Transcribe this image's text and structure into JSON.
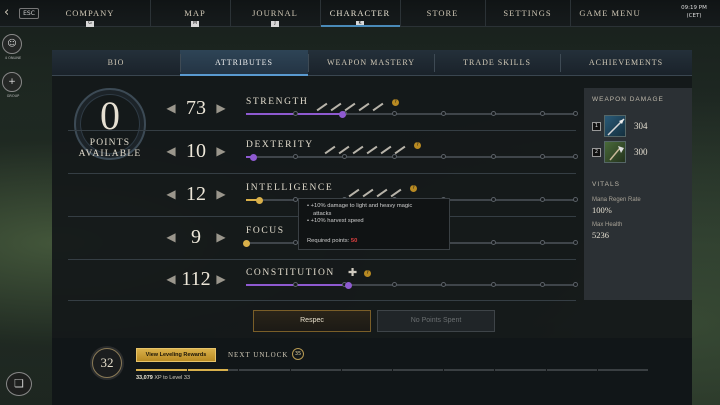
{
  "topnav": {
    "back_glyph": "‹",
    "esc_label": "ESC",
    "items": [
      {
        "label": "COMPANY",
        "hotkey": "G"
      },
      {
        "label": "MAP",
        "hotkey": "M"
      },
      {
        "label": "JOURNAL",
        "hotkey": "J"
      },
      {
        "label": "CHARACTER",
        "hotkey": "K"
      },
      {
        "label": "STORE",
        "hotkey": ""
      },
      {
        "label": "SETTINGS",
        "hotkey": ""
      },
      {
        "label": "GAME MENU",
        "hotkey": ""
      }
    ],
    "active_index": 3,
    "clock_time": "09:19 PM",
    "clock_tz": "(CET)"
  },
  "side": {
    "online_label": "4 ONLINE",
    "invite_label": "GROUP",
    "chat_icon": "chat-bubble-icon"
  },
  "subtabs": {
    "items": [
      "BIO",
      "ATTRIBUTES",
      "WEAPON MASTERY",
      "TRADE SKILLS",
      "ACHIEVEMENTS"
    ],
    "active_index": 1
  },
  "points": {
    "value": "0",
    "label_line1": "POINTS",
    "label_line2": "AVAILABLE"
  },
  "attributes": [
    {
      "name": "STRENGTH",
      "value": "73",
      "fill": 0.29,
      "color": "#8e5ad0",
      "info": "?",
      "weapons": 5,
      "plus": ""
    },
    {
      "name": "DEXTERITY",
      "value": "10",
      "fill": 0.02,
      "color": "#8e5ad0",
      "info": "?",
      "weapons": 6,
      "plus": ""
    },
    {
      "name": "INTELLIGENCE",
      "value": "12",
      "fill": 0.04,
      "color": "#d9b04a",
      "info": "?",
      "weapons": 4,
      "plus": ""
    },
    {
      "name": "FOCUS",
      "value": "9",
      "fill": 0.0,
      "color": "#d9b04a",
      "info": "",
      "weapons": 0,
      "plus": ""
    },
    {
      "name": "CONSTITUTION",
      "value": "112",
      "fill": 0.31,
      "color": "#8e5ad0",
      "info": "?",
      "weapons": 0,
      "plus": "✚"
    }
  ],
  "tooltip": {
    "line1": "• +10% damage to light and heavy magic",
    "line1b": "attacks",
    "line2": "• +10% harvest speed",
    "req_label": "Required points:",
    "req_value": "50"
  },
  "weapon_damage": {
    "title": "WEAPON DAMAGE",
    "slots": [
      {
        "num": "1",
        "value": "304",
        "icon": "spear-icon"
      },
      {
        "num": "2",
        "value": "300",
        "icon": "hatchet-icon"
      }
    ]
  },
  "vitals": {
    "title": "VITALS",
    "mana_regen_label": "Mana Regen Rate",
    "mana_regen_value": "100%",
    "max_health_label": "Max Health",
    "max_health_value": "5236"
  },
  "buttons": {
    "respec": "Respec",
    "no_points": "No Points Spent"
  },
  "level": {
    "value": "32",
    "rewards_label": "View Leveling Rewards",
    "next_unlock_label": "NEXT UNLOCK",
    "next_unlock_level": "35",
    "xp_value": "33,079",
    "xp_label": "XP",
    "xp_to_label": "to Level 33",
    "xp_progress": 0.18
  },
  "colors": {
    "accent_blue": "#4a8ab8",
    "gold": "#d9b04a",
    "purple": "#8e5ad0",
    "required_red": "#e04040"
  }
}
